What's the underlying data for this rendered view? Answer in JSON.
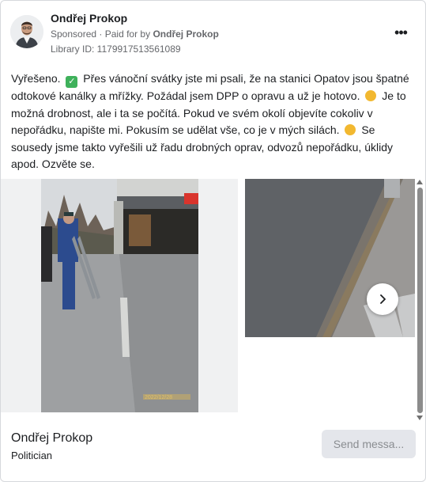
{
  "post": {
    "author": "Ondřej Prokop",
    "sponsored": "Sponsored",
    "paid_prefix": "Paid for by",
    "paid_by": "Ondřej Prokop",
    "library_id": "Library ID: 1179917513561089",
    "text_1": "Vyřešeno.",
    "text_2": "Přes vánoční svátky jste mi psali, že na stanici Opatov jsou špatné odtokové kanálky a mřížky. Požádal jsem DPP o opravu a už je hotovo.",
    "text_3": "Je to možná drobnost, ale i ta se počítá. Pokud ve svém okolí objevíte cokoliv v nepořádku, napište mi. Pokusím se udělat vše, co je v mých silách.",
    "text_4": "Se sousedy jsme takto vyřešili už řadu drobných oprav, odvozů nepořádku, úklidy apod. Ozvěte se.",
    "more_icon": "•••",
    "photo_timestamp": "2022/12/28"
  },
  "footer": {
    "page_name": "Ondřej Prokop",
    "category": "Politician",
    "send_button": "Send messa..."
  },
  "icons": [
    "avatar",
    "more-options-icon",
    "check-mark-emoji",
    "waving-hand-emoji",
    "thumbs-up-emoji",
    "chevron-right-icon"
  ],
  "colors": {
    "check_emoji": "#3fb15b",
    "secondary_text": "#65676b",
    "button_bg": "#e4e6eb"
  }
}
